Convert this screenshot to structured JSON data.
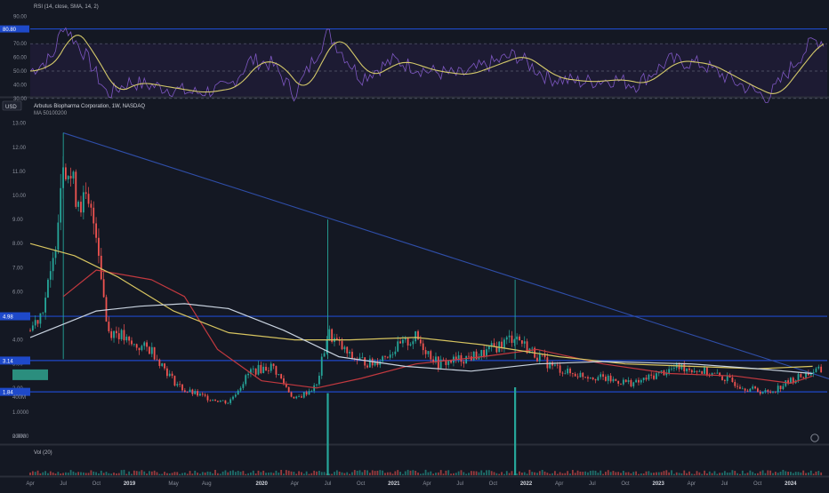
{
  "rsi_panel": {
    "title": "RSI (14, close, SMA, 14, 2)",
    "y_ticks": [
      "90.00",
      "70.00",
      "60.00",
      "50.00",
      "40.00",
      "30.00"
    ],
    "marker_label": "80.80"
  },
  "price_panel": {
    "currency": "USD",
    "title": "Arbutus Biopharma Corporation, 1W, NASDAQ",
    "subtitle": "MA 50100200",
    "y_ticks": [
      "13.00",
      "12.00",
      "11.00",
      "10.00",
      "9.00",
      "8.00",
      "7.00",
      "6.00",
      "5.00",
      "4.00",
      "3.00",
      "2.00",
      "1.0000",
      "0.0000"
    ],
    "level_labels": [
      "4.98",
      "3.14",
      "1.84"
    ]
  },
  "volume_panel": {
    "title": "Vol (20)",
    "y_ticks": [
      "400M",
      "200M"
    ]
  },
  "x_axis": {
    "labels": [
      "Apr",
      "Jul",
      "Oct",
      "2019",
      "May",
      "Aug",
      "2020",
      "Apr",
      "Jul",
      "Oct",
      "2021",
      "Apr",
      "Jul",
      "Oct",
      "2022",
      "Apr",
      "Jul",
      "Oct",
      "2023",
      "Apr",
      "Jul",
      "Oct",
      "2024"
    ]
  },
  "colors": {
    "background": "#141823",
    "up": "#26a69a",
    "down": "#ef5350",
    "rsi_line": "#7e57c2",
    "rsi_ma": "#d4c96a",
    "ma50": "#c2393f",
    "ma100": "#d8c560",
    "ma200": "#c9d3e0",
    "level_lines": "#1e49c9",
    "trendline": "#2f4ea8"
  },
  "chart_data": {
    "type": "candlestick",
    "title": "Arbutus Biopharma Corporation, 1W, NASDAQ",
    "interval": "1W",
    "y_range": [
      0,
      13.5
    ],
    "horizontal_levels": [
      4.98,
      3.14,
      1.84
    ],
    "trendline": {
      "from": {
        "date": "2018-07",
        "price": 12.6
      },
      "to": {
        "date": "2024-03",
        "price": 2.6
      }
    },
    "price_path": [
      {
        "date": "2018-04",
        "price": 4.4
      },
      {
        "date": "2018-05",
        "price": 5.2
      },
      {
        "date": "2018-06",
        "price": 6.8
      },
      {
        "date": "2018-07",
        "price": 11.8
      },
      {
        "date": "2018-08",
        "price": 10.2
      },
      {
        "date": "2018-09",
        "price": 9.6
      },
      {
        "date": "2018-10",
        "price": 8.7
      },
      {
        "date": "2018-11",
        "price": 4.4
      },
      {
        "date": "2018-12",
        "price": 4.3
      },
      {
        "date": "2019-01",
        "price": 3.8
      },
      {
        "date": "2019-03",
        "price": 3.6
      },
      {
        "date": "2019-05",
        "price": 2.3
      },
      {
        "date": "2019-06",
        "price": 1.9
      },
      {
        "date": "2019-08",
        "price": 1.6
      },
      {
        "date": "2019-10",
        "price": 1.4
      },
      {
        "date": "2019-12",
        "price": 2.7
      },
      {
        "date": "2020-02",
        "price": 2.9
      },
      {
        "date": "2020-04",
        "price": 1.5
      },
      {
        "date": "2020-06",
        "price": 2.1
      },
      {
        "date": "2020-07",
        "price": 4.3
      },
      {
        "date": "2020-09",
        "price": 3.3
      },
      {
        "date": "2020-11",
        "price": 3.0
      },
      {
        "date": "2021-01",
        "price": 3.6
      },
      {
        "date": "2021-03",
        "price": 4.1
      },
      {
        "date": "2021-05",
        "price": 3.0
      },
      {
        "date": "2021-07",
        "price": 3.2
      },
      {
        "date": "2021-09",
        "price": 3.4
      },
      {
        "date": "2021-11",
        "price": 3.9
      },
      {
        "date": "2021-12",
        "price": 4.2
      },
      {
        "date": "2022-01",
        "price": 3.7
      },
      {
        "date": "2022-03",
        "price": 3.0
      },
      {
        "date": "2022-05",
        "price": 2.6
      },
      {
        "date": "2022-07",
        "price": 2.5
      },
      {
        "date": "2022-09",
        "price": 2.3
      },
      {
        "date": "2022-11",
        "price": 2.2
      },
      {
        "date": "2023-01",
        "price": 2.6
      },
      {
        "date": "2023-03",
        "price": 2.9
      },
      {
        "date": "2023-05",
        "price": 2.7
      },
      {
        "date": "2023-07",
        "price": 2.4
      },
      {
        "date": "2023-09",
        "price": 2.0
      },
      {
        "date": "2023-11",
        "price": 1.8
      },
      {
        "date": "2024-01",
        "price": 2.3
      },
      {
        "date": "2024-03",
        "price": 2.7
      }
    ],
    "series": [
      {
        "name": "MA 50",
        "points": [
          [
            "2018-07",
            5.8
          ],
          [
            "2018-10",
            6.9
          ],
          [
            "2019-03",
            6.5
          ],
          [
            "2019-06",
            5.8
          ],
          [
            "2019-09",
            3.6
          ],
          [
            "2020-01",
            2.3
          ],
          [
            "2020-06",
            2.0
          ],
          [
            "2020-10",
            2.4
          ],
          [
            "2021-03",
            3.0
          ],
          [
            "2021-09",
            3.3
          ],
          [
            "2022-02",
            3.6
          ],
          [
            "2022-08",
            3.0
          ],
          [
            "2023-02",
            2.6
          ],
          [
            "2023-08",
            2.5
          ],
          [
            "2024-01",
            2.2
          ],
          [
            "2024-03",
            2.5
          ]
        ]
      },
      {
        "name": "MA 100",
        "points": [
          [
            "2018-04",
            8.0
          ],
          [
            "2018-08",
            7.5
          ],
          [
            "2018-12",
            6.6
          ],
          [
            "2019-05",
            5.2
          ],
          [
            "2019-10",
            4.3
          ],
          [
            "2020-04",
            4.0
          ],
          [
            "2020-09",
            4.0
          ],
          [
            "2021-03",
            4.1
          ],
          [
            "2021-09",
            3.8
          ],
          [
            "2022-04",
            3.3
          ],
          [
            "2022-10",
            3.0
          ],
          [
            "2023-04",
            2.9
          ],
          [
            "2023-10",
            2.8
          ],
          [
            "2024-03",
            2.9
          ]
        ]
      },
      {
        "name": "MA 200",
        "points": [
          [
            "2018-04",
            4.1
          ],
          [
            "2018-10",
            5.2
          ],
          [
            "2019-02",
            5.4
          ],
          [
            "2019-06",
            5.5
          ],
          [
            "2019-10",
            5.3
          ],
          [
            "2020-03",
            4.4
          ],
          [
            "2020-08",
            3.3
          ],
          [
            "2021-02",
            2.9
          ],
          [
            "2021-08",
            2.7
          ],
          [
            "2022-02",
            3.0
          ],
          [
            "2022-08",
            3.1
          ],
          [
            "2023-04",
            3.0
          ],
          [
            "2023-10",
            2.8
          ],
          [
            "2024-03",
            2.6
          ]
        ]
      }
    ],
    "rsi": {
      "range": [
        25,
        90
      ],
      "levels": [
        30,
        50,
        70
      ],
      "points": [
        [
          "2018-04",
          50
        ],
        [
          "2018-06",
          60
        ],
        [
          "2018-07",
          84
        ],
        [
          "2018-09",
          62
        ],
        [
          "2018-11",
          33
        ],
        [
          "2019-01",
          42
        ],
        [
          "2019-04",
          38
        ],
        [
          "2019-07",
          34
        ],
        [
          "2019-10",
          38
        ],
        [
          "2019-12",
          58
        ],
        [
          "2020-02",
          55
        ],
        [
          "2020-04",
          33
        ],
        [
          "2020-07",
          78
        ],
        [
          "2020-10",
          45
        ],
        [
          "2021-01",
          58
        ],
        [
          "2021-04",
          50
        ],
        [
          "2021-07",
          47
        ],
        [
          "2021-10",
          56
        ],
        [
          "2021-12",
          62
        ],
        [
          "2022-03",
          45
        ],
        [
          "2022-06",
          42
        ],
        [
          "2022-09",
          44
        ],
        [
          "2022-11",
          40
        ],
        [
          "2023-02",
          58
        ],
        [
          "2023-05",
          55
        ],
        [
          "2023-08",
          42
        ],
        [
          "2023-10",
          34
        ],
        [
          "2023-11",
          31
        ],
        [
          "2024-01",
          52
        ],
        [
          "2024-03",
          72
        ]
      ]
    },
    "volume_spikes": [
      {
        "date": "2020-07",
        "volume_m": 420
      },
      {
        "date": "2021-12",
        "volume_m": 450
      }
    ]
  }
}
